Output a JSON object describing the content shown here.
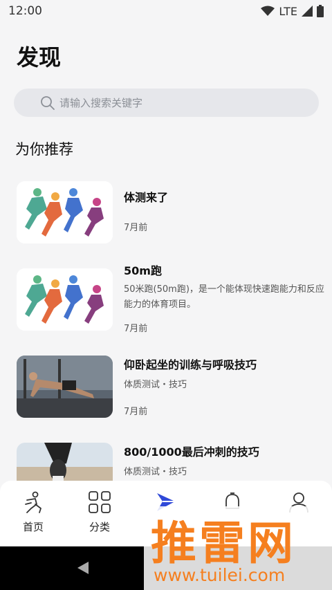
{
  "status": {
    "time": "12:00",
    "network": "LTE"
  },
  "page": {
    "title": "发现"
  },
  "search": {
    "placeholder": "请输入搜索关键字"
  },
  "section": {
    "title": "为你推荐"
  },
  "items": [
    {
      "title": "体测来了",
      "desc": "",
      "time": "7月前",
      "image": "runners-illustration"
    },
    {
      "title": "50m跑",
      "desc": "50米跑(50m跑)，是一个能体现快速跑能力和反应能力的体育项目。",
      "time": "7月前",
      "image": "runners-illustration"
    },
    {
      "title": "仰卧起坐的训练与呼吸技巧",
      "desc": "体质测试・技巧",
      "time": "7月前",
      "image": "gym-photo"
    },
    {
      "title": "800/1000最后冲刺的技巧",
      "desc": "体质测试・技巧",
      "time": "",
      "image": "running-shoes-photo"
    }
  ],
  "tabs": [
    {
      "label": "首页",
      "icon": "runner-icon"
    },
    {
      "label": "分类",
      "icon": "grid-icon"
    },
    {
      "label": "",
      "icon": "discover-icon",
      "active": true
    },
    {
      "label": "",
      "icon": "bell-icon"
    },
    {
      "label": "",
      "icon": "user-icon"
    }
  ],
  "watermark": {
    "text": "推雷网",
    "url": "www.tuilei.com"
  },
  "colors": {
    "accent": "#2f49d8",
    "watermark": "#f57f1f",
    "search_bg": "#e6e7eb"
  }
}
